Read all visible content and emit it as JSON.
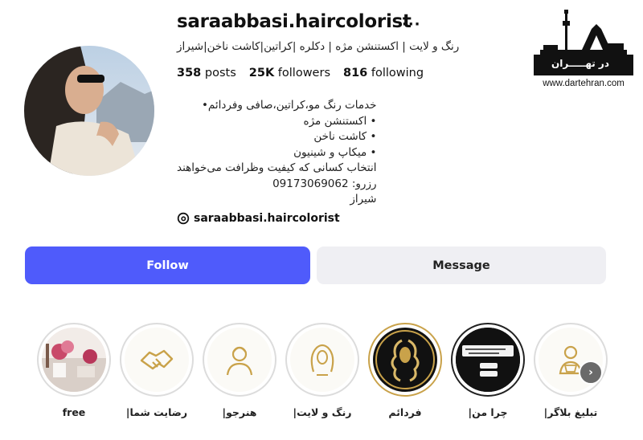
{
  "profile": {
    "username": "saraabbasi.haircolorist",
    "more_label": "···",
    "full_name": "رنگ و لایت | اکستنشن مژه | دکلره |کراتین|کاشت ناخن|شیراز",
    "stats": {
      "posts_count": "358",
      "posts_label": "posts",
      "followers_count": "25K",
      "followers_label": "followers",
      "following_count": "816",
      "following_label": "following"
    },
    "bio_lines": [
      "خدمات رنگ مو،کراتین،صافی وفردائم•",
      "• اکستنشن مژه",
      "• کاشت ناخن",
      "• میکاپ و شینیون",
      "انتخاب کسانی که کیفیت وظرافت می‌خواهند",
      "رزرو: 09173069062",
      "شیراز"
    ],
    "threads_handle": "saraabbasi.haircolorist"
  },
  "actions": {
    "follow_label": "Follow",
    "message_label": "Message"
  },
  "watermark": {
    "logo_text": "در تهـــــران",
    "url": "www.dartehran.com"
  },
  "highlights": [
    {
      "label": "free",
      "icon": "photo-thumbnail"
    },
    {
      "label": "|رضایت شما",
      "icon": "handshake-icon"
    },
    {
      "label": "|هنرجو",
      "icon": "student-icon"
    },
    {
      "label": "|رنگ و لایت",
      "icon": "hair-icon"
    },
    {
      "label": "فردائم",
      "icon": "curly-hair-icon"
    },
    {
      "label": "|چرا من",
      "icon": "text-screenshot"
    },
    {
      "label": "|تبلیغ بلاگر",
      "icon": "blogger-icon"
    }
  ],
  "colors": {
    "follow": "#4f5bfb",
    "message": "#efeff3",
    "ring": "#dcdcdc",
    "gold": "#c9a24a"
  }
}
